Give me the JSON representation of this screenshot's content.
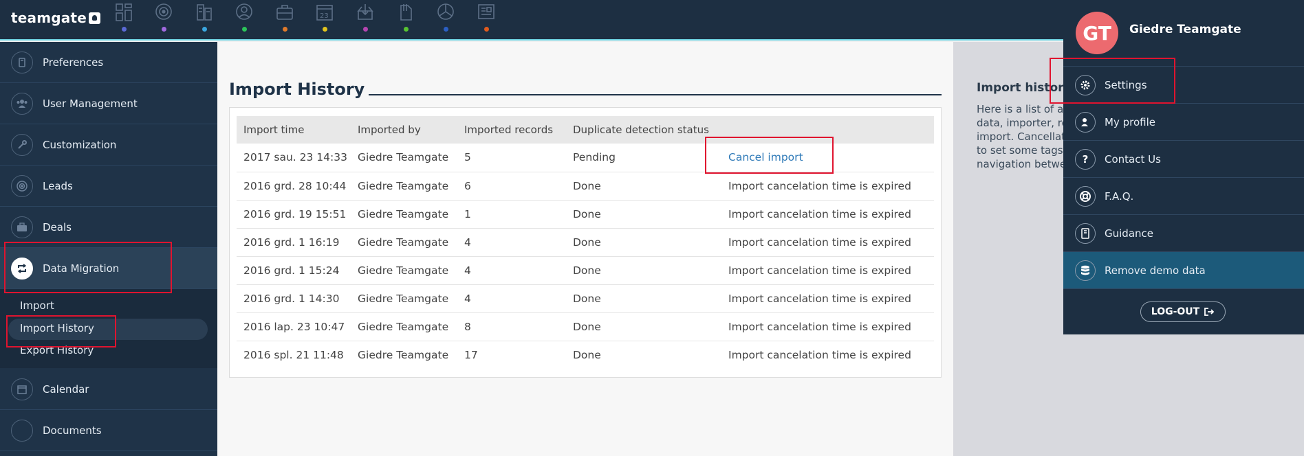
{
  "app": {
    "logo": "teamgate"
  },
  "topbar": {
    "icons": [
      {
        "name": "dashboard-icon",
        "dot": "#5b6ad6"
      },
      {
        "name": "target-icon",
        "dot": "#a16ae0"
      },
      {
        "name": "companies-icon",
        "dot": "#3aa6e0"
      },
      {
        "name": "contacts-icon",
        "dot": "#2bc45a"
      },
      {
        "name": "deals-icon",
        "dot": "#e07a2b"
      },
      {
        "name": "calendar-icon",
        "dot": "#e2c41e"
      },
      {
        "name": "inbox-icon",
        "dot": "#b545b0"
      },
      {
        "name": "documents-icon",
        "dot": "#58c431"
      },
      {
        "name": "reports-icon",
        "dot": "#2b5fc4"
      },
      {
        "name": "newsfeed-icon",
        "dot": "#e05b1e"
      }
    ]
  },
  "sidebar": {
    "items": [
      {
        "label": "Preferences"
      },
      {
        "label": "User Management"
      },
      {
        "label": "Customization"
      },
      {
        "label": "Leads"
      },
      {
        "label": "Deals"
      },
      {
        "label": "Data Migration"
      },
      {
        "label": "Calendar"
      },
      {
        "label": "Documents"
      }
    ],
    "subitems": [
      {
        "label": "Import"
      },
      {
        "label": "Import History"
      },
      {
        "label": "Export History"
      }
    ]
  },
  "main": {
    "title": "Import History",
    "columns": [
      "Import time",
      "Imported by",
      "Imported records",
      "Duplicate detection status",
      ""
    ],
    "rows": [
      [
        "2017 sau. 23 14:33",
        "Giedre Teamgate",
        "5",
        "Pending",
        "Cancel import"
      ],
      [
        "2016 grd. 28 10:44",
        "Giedre Teamgate",
        "6",
        "Done",
        "Import cancelation time is expired"
      ],
      [
        "2016 grd. 19 15:51",
        "Giedre Teamgate",
        "1",
        "Done",
        "Import cancelation time is expired"
      ],
      [
        "2016 grd. 1 16:19",
        "Giedre Teamgate",
        "4",
        "Done",
        "Import cancelation time is expired"
      ],
      [
        "2016 grd. 1 15:24",
        "Giedre Teamgate",
        "4",
        "Done",
        "Import cancelation time is expired"
      ],
      [
        "2016 grd. 1 14:30",
        "Giedre Teamgate",
        "4",
        "Done",
        "Import cancelation time is expired"
      ],
      [
        "2016 lap. 23 10:47",
        "Giedre Teamgate",
        "8",
        "Done",
        "Import cancelation time is expired"
      ],
      [
        "2016 spl. 21 11:48",
        "Giedre Teamgate",
        "17",
        "Done",
        "Import cancelation time is expired"
      ]
    ]
  },
  "info": {
    "title": "Import history",
    "lines": [
      "Here is a list of al",
      "data, importer, re",
      "import. Cancellat",
      "to set some tags t",
      "navigation betwe"
    ]
  },
  "dropdown": {
    "initials": "GT",
    "user_name": "Giedre Teamgate",
    "items": [
      {
        "label": "Settings",
        "icon": "gear-icon"
      },
      {
        "label": "My profile",
        "icon": "profile-icon"
      },
      {
        "label": "Contact Us",
        "icon": "question-icon"
      },
      {
        "label": "F.A.Q.",
        "icon": "lifebuoy-icon"
      },
      {
        "label": "Guidance",
        "icon": "book-icon"
      },
      {
        "label": "Remove demo data",
        "icon": "database-icon"
      }
    ],
    "logout": "LOG-OUT"
  },
  "colors": {
    "accent": "#6fd6e4",
    "highlight": "#e0142f",
    "avatar": "#ec6a6f",
    "link": "#2f7ab8"
  }
}
